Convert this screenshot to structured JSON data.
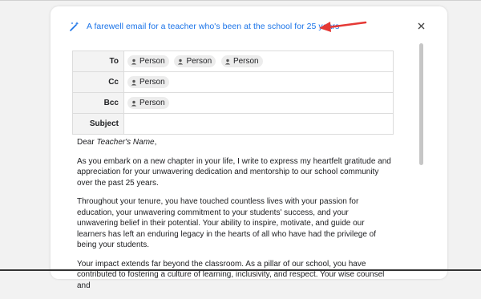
{
  "title": "A farewell email for a teacher who's been at the school for 25 years",
  "fields": {
    "to": {
      "label": "To",
      "recipients": [
        "Person",
        "Person",
        "Person"
      ]
    },
    "cc": {
      "label": "Cc",
      "recipients": [
        "Person"
      ]
    },
    "bcc": {
      "label": "Bcc",
      "recipients": [
        "Person"
      ]
    },
    "subject": {
      "label": "Subject",
      "value": ""
    }
  },
  "body": {
    "greeting_prefix": "Dear ",
    "greeting_name": "Teacher's Name",
    "greeting_suffix": ",",
    "paragraphs": [
      "As you embark on a new chapter in your life, I write to express my heartfelt gratitude and appreciation for your unwavering dedication and mentorship to our school community over the past 25 years.",
      "Throughout your tenure, you have touched countless lives with your passion for education, your unwavering commitment to your students' success, and your unwavering belief in their potential. Your ability to inspire, motivate, and guide our learners has left an enduring legacy in the hearts of all who have had the privilege of being your students.",
      "Your impact extends far beyond the classroom. As a pillar of our school, you have contributed to fostering a culture of learning, inclusivity, and respect. Your wise counsel and"
    ]
  },
  "icons": {
    "title": "magic-wand-icon",
    "close": "close-icon",
    "person": "person-icon",
    "annotation": "arrow-icon"
  },
  "colors": {
    "accent": "#1a73e8",
    "annotation_arrow": "#e53935"
  }
}
